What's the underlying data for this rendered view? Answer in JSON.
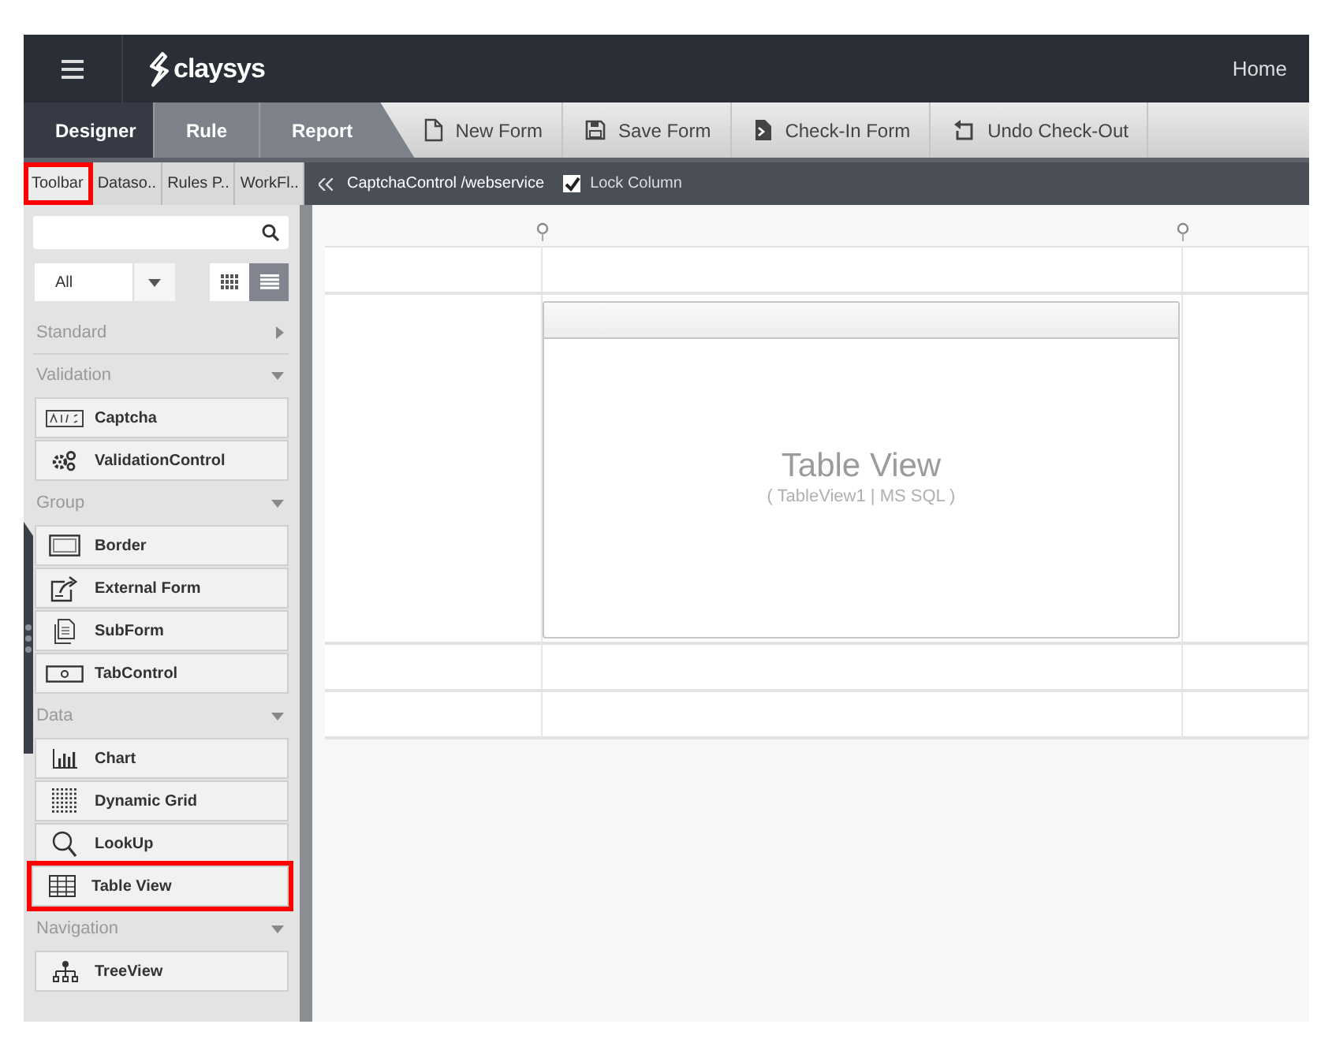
{
  "header": {
    "logo": "claysys",
    "home": "Home"
  },
  "mode_tabs": [
    {
      "label": "Designer",
      "selected": true
    },
    {
      "label": "Rule",
      "selected": false
    },
    {
      "label": "Report",
      "selected": false
    }
  ],
  "actions": [
    {
      "label": "New Form",
      "kind": "new"
    },
    {
      "label": "Save Form",
      "kind": "save"
    },
    {
      "label": "Check-In Form",
      "kind": "checkin"
    },
    {
      "label": "Undo Check-Out",
      "kind": "undo"
    }
  ],
  "panel_tabs": [
    {
      "label": "Toolbar",
      "selected": true,
      "highlighted": true
    },
    {
      "label": "Dataso..",
      "selected": false,
      "highlighted": false
    },
    {
      "label": "Rules P..",
      "selected": false,
      "highlighted": false
    },
    {
      "label": "WorkFl..",
      "selected": false,
      "highlighted": false
    }
  ],
  "breadcrumb": "CaptchaControl /webservice",
  "lock_column": {
    "label": "Lock Column",
    "checked": true
  },
  "filter": {
    "value": "All"
  },
  "view_toggles": [
    {
      "kind": "grid",
      "selected": false
    },
    {
      "kind": "list",
      "selected": true
    }
  ],
  "sections": [
    {
      "title": "Standard",
      "expanded": false
    },
    {
      "title": "Validation",
      "expanded": true,
      "items": [
        {
          "label": "Captcha",
          "kind": "captcha",
          "highlighted": false
        },
        {
          "label": "ValidationControl",
          "kind": "gears",
          "highlighted": false
        }
      ]
    },
    {
      "title": "Group",
      "expanded": true,
      "items": [
        {
          "label": "Border",
          "kind": "border",
          "highlighted": false
        },
        {
          "label": "External Form",
          "kind": "external",
          "highlighted": false
        },
        {
          "label": "SubForm",
          "kind": "subform",
          "highlighted": false
        },
        {
          "label": "TabControl",
          "kind": "tab",
          "highlighted": false
        }
      ]
    },
    {
      "title": "Data",
      "expanded": true,
      "items": [
        {
          "label": "Chart",
          "kind": "chart",
          "highlighted": false
        },
        {
          "label": "Dynamic Grid",
          "kind": "dots",
          "highlighted": false
        },
        {
          "label": "LookUp",
          "kind": "lookup",
          "highlighted": false
        },
        {
          "label": "Table View",
          "kind": "table",
          "highlighted": true
        }
      ]
    },
    {
      "title": "Navigation",
      "expanded": true,
      "items": [
        {
          "label": "TreeView",
          "kind": "tree",
          "highlighted": false
        }
      ]
    }
  ],
  "table_view": {
    "title": "Table View",
    "subtitle": "( TableView1 | MS SQL )"
  }
}
